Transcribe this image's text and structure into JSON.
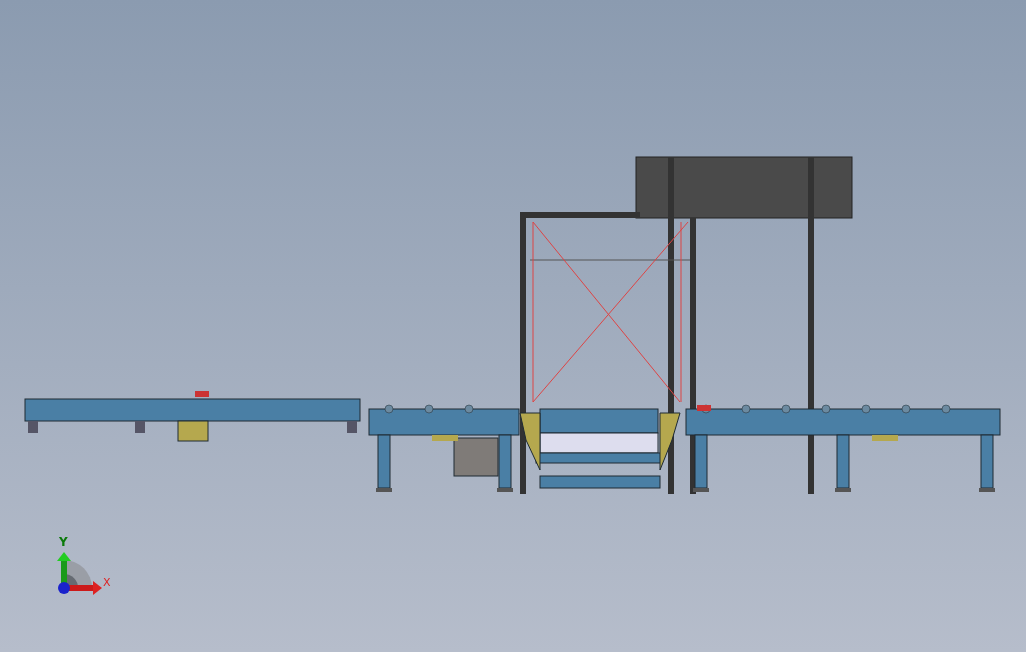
{
  "viewport": {
    "triad": {
      "axes": [
        {
          "label": "Y",
          "kind": "vertical"
        },
        {
          "label": "X",
          "kind": "horizontal"
        }
      ]
    }
  }
}
